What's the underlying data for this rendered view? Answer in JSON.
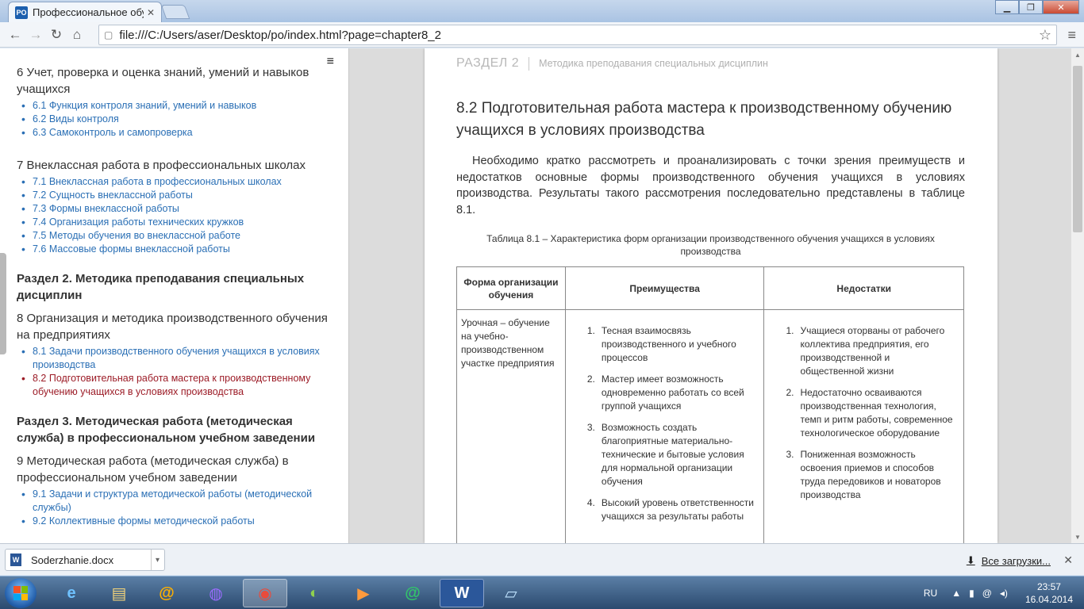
{
  "browser": {
    "tab_title": "Профессиональное обучение",
    "favicon_text": "PO",
    "url": "file:///C:/Users/aser/Desktop/po/index.html?page=chapter8_2"
  },
  "sidebar": {
    "chapter6": {
      "title": "6 Учет, проверка и оценка знаний, умений и навыков учащихся",
      "items": [
        "6.1 Функция контроля знаний, умений и навыков",
        "6.2 Виды контроля",
        "6.3 Самоконтроль и самопроверка"
      ]
    },
    "chapter7": {
      "title": "7 Внеклассная работа в профессиональных школах",
      "items": [
        "7.1 Внеклассная работа в профессиональных школах",
        "7.2 Сущность внеклассной работы",
        "7.3 Формы внеклассной работы",
        "7.4 Организация работы технических кружков",
        "7.5 Методы обучения во внеклассной работе",
        "7.6 Массовые формы внеклассной работы"
      ]
    },
    "section2": "Раздел 2. Методика преподавания специальных дисциплин",
    "chapter8": {
      "title": "8 Организация и методика производственного обучения на предприятиях",
      "items": [
        "8.1 Задачи производственного обучения учащихся в условиях производства",
        "8.2 Подготовительная работа мастера к производственному обучению учащихся в условиях производства"
      ]
    },
    "section3": "Раздел 3. Методическая работа (методическая служба) в профессиональном учебном заведении",
    "chapter9": {
      "title": "9 Методическая работа (методическая служба) в профессиональном учебном заведении",
      "items": [
        "9.1 Задачи и структура методической работы (методической службы)",
        "9.2 Коллективные формы методической работы"
      ]
    }
  },
  "page": {
    "header_razdel": "РАЗДЕЛ 2",
    "header_subtitle": "Методика преподавания специальных дисциплин",
    "title": "8.2 Подготовительная работа мастера к производственному обучению учащихся в условиях производства",
    "paragraph": "Необходимо кратко рассмотреть и проанализировать с точки зрения преимуществ и недостатков основные формы производственного обучения учащихся в условиях производства. Результаты такого рассмотрения последовательно представлены в таблице 8.1.",
    "table_caption": "Таблица 8.1 – Характеристика форм организации производственного обучения учащихся в условиях производства",
    "table": {
      "headers": [
        "Форма организации обучения",
        "Преимущества",
        "Недостатки"
      ],
      "row1": {
        "form": "Урочная – обучение на учебно-производственном участке предприятия",
        "advantages": [
          "Тесная взаимосвязь производственного и учебного процессов",
          "Мастер имеет возможность одновременно работать со всей группой учащихся",
          "Возможность создать благоприятные материально-технические и бытовые условия для нормальной организации обучения",
          "Высокий уровень ответственности учащихся за результаты работы"
        ],
        "disadvantages": [
          "Учащиеся оторваны от рабочего коллектива предприятия, его производственной и общественной жизни",
          "Недостаточно осваиваются производственная технология, темп и ритм работы, современное технологическое оборудование",
          "Пониженная возможность освоения приемов и способов труда передовиков и новаторов производства"
        ]
      }
    }
  },
  "downloads": {
    "file_name": "Soderzhanie.docx",
    "file_icon_text": "W",
    "all_downloads": "Все загрузки..."
  },
  "taskbar": {
    "lang": "RU",
    "time": "23:57",
    "date": "16.04.2014",
    "apps": [
      "internet-explorer",
      "file-explorer",
      "mail-ru-agent",
      "orbit-browser",
      "chrome",
      "media-app",
      "video-player",
      "mail-agent",
      "word",
      "notepad"
    ]
  }
}
